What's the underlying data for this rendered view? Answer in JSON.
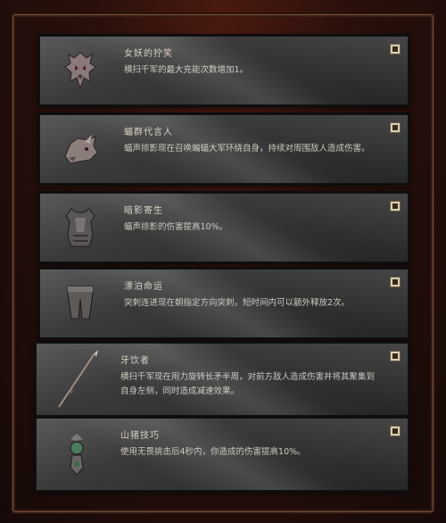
{
  "cards": [
    {
      "icon": "demon-mask-icon",
      "title": "女妖的狞笑",
      "desc": "横扫千军的最大充能次数增加1。"
    },
    {
      "icon": "beast-head-icon",
      "title": "蝠群代言人",
      "desc": "蝠声掠影现在召唤蝙蝠大军环绕自身，持续对周围敌人造成伤害。"
    },
    {
      "icon": "chest-armor-icon",
      "title": "暗影寄生",
      "desc": "蝠声掠影的伤害提高10%。"
    },
    {
      "icon": "leg-armor-icon",
      "title": "漂泊命运",
      "desc": "突刺连进现在朝指定方向突刺，短时间内可以额外释放2次。"
    },
    {
      "icon": "spear-icon",
      "title": "牙饮者",
      "desc": "横扫千军现在用力旋转长矛半周，对前方敌人造成伤害并将其聚集到自身左侧，同时造成减速效果。"
    },
    {
      "icon": "amulet-icon",
      "title": "山猪技巧",
      "desc": "使用无畏挑击后4秒内，你造成的伤害提高10%。"
    }
  ],
  "colors": {
    "card_top": "#5a5a5a",
    "card_bottom": "#262626",
    "frame_border": "#7a5a3a",
    "background": "#2a100b"
  }
}
